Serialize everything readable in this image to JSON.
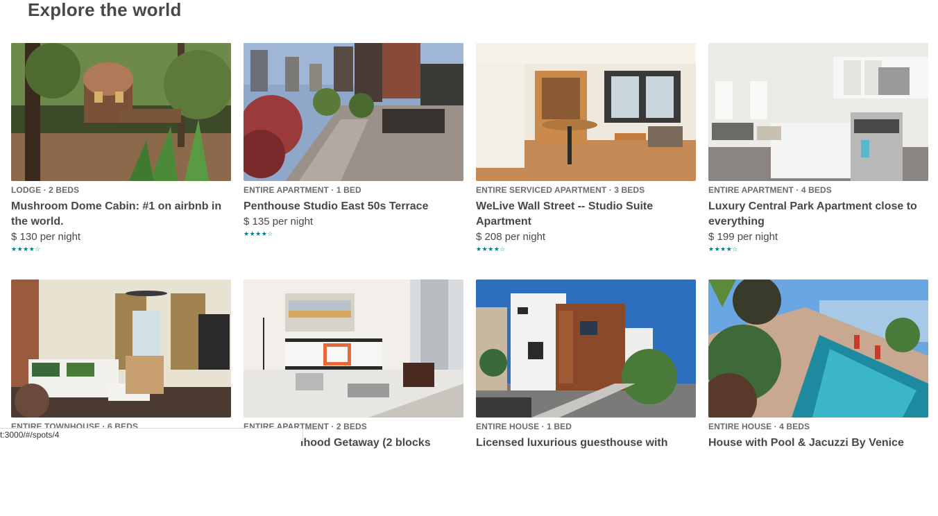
{
  "page": {
    "title": "Explore the world"
  },
  "listings": [
    {
      "meta": "LODGE · 2 BEDS",
      "title": "Mushroom Dome Cabin: #1 on airbnb in the world.",
      "price": "$ 130 per night",
      "rating": 4,
      "image": "cabin-in-forest"
    },
    {
      "meta": "ENTIRE APARTMENT · 1 BED",
      "title": "Penthouse Studio East 50s Terrace",
      "price": "$ 135 per night",
      "rating": 4,
      "image": "rooftop-terrace"
    },
    {
      "meta": "ENTIRE SERVICED APARTMENT · 3 BEDS",
      "title": "WeLive Wall Street -- Studio Suite Apartment",
      "price": "$ 208 per night",
      "rating": 4,
      "image": "studio-interior"
    },
    {
      "meta": "ENTIRE APARTMENT · 4 BEDS",
      "title": "Luxury Central Park Apartment close to everything",
      "price": "$ 199 per night",
      "rating": 4,
      "image": "white-kitchen"
    },
    {
      "meta": "ENTIRE TOWNHOUSE · 6 BEDS",
      "title": "",
      "price": "",
      "rating": 0,
      "image": "townhouse-living-room"
    },
    {
      "meta": "ENTIRE APARTMENT · 2 BEDS",
      "title": "lhood Getaway (2 blocks",
      "price": "",
      "rating": 0,
      "image": "bedroom"
    },
    {
      "meta": "ENTIRE HOUSE · 1 BED",
      "title": "Licensed luxurious guesthouse with",
      "price": "",
      "rating": 0,
      "image": "modern-house"
    },
    {
      "meta": "ENTIRE HOUSE · 4 BEDS",
      "title": "House with Pool & Jacuzzi By Venice",
      "price": "",
      "rating": 0,
      "image": "pool-backyard"
    }
  ],
  "status_bar": {
    "url": "t:3000/#/spots/4"
  },
  "colors": {
    "star": "#007a87",
    "text": "#484848",
    "meta": "#6b6b6b"
  }
}
